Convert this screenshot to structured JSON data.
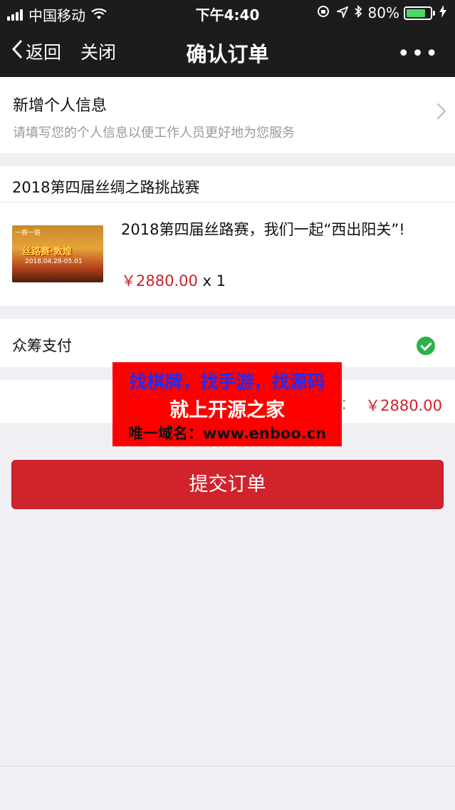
{
  "status": {
    "carrier": "中国移动",
    "time": "下午4:40",
    "battery_pct": "80%",
    "battery_level": 0.8,
    "icons": [
      "signal-icon",
      "wifi-icon",
      "orientation-lock-icon",
      "location-icon",
      "bluetooth-icon",
      "battery-icon",
      "charging-icon"
    ]
  },
  "nav": {
    "back_label": "返回",
    "close_label": "关闭",
    "title": "确认订单",
    "more": "•••"
  },
  "info": {
    "title": "新增个人信息",
    "description": "请填写您的个人信息以便工作人员更好地为您服务"
  },
  "event": {
    "header": "2018第四届丝绸之路挑战赛",
    "image_text": {
      "top": "一赛一路",
      "banner": "丝路赛·敦煌",
      "dates": "2018.04.28-05.01"
    },
    "name": "2018第四届丝路赛，我们一起“西出阳关”!",
    "price": "￥2880.00",
    "quantity": "x 1"
  },
  "payment": {
    "label": "众筹支付"
  },
  "total": {
    "colon": "：",
    "amount": "￥2880.00"
  },
  "ad": {
    "line1": "找棋牌，找手游，找源码",
    "line2": "就上开源之家",
    "line3": "唯一域名：www.enboo.cn"
  },
  "submit": {
    "label": "提交订单"
  },
  "colors": {
    "accent": "#d0232c",
    "check": "#2bb24c",
    "navbar": "#1c1c1c"
  }
}
